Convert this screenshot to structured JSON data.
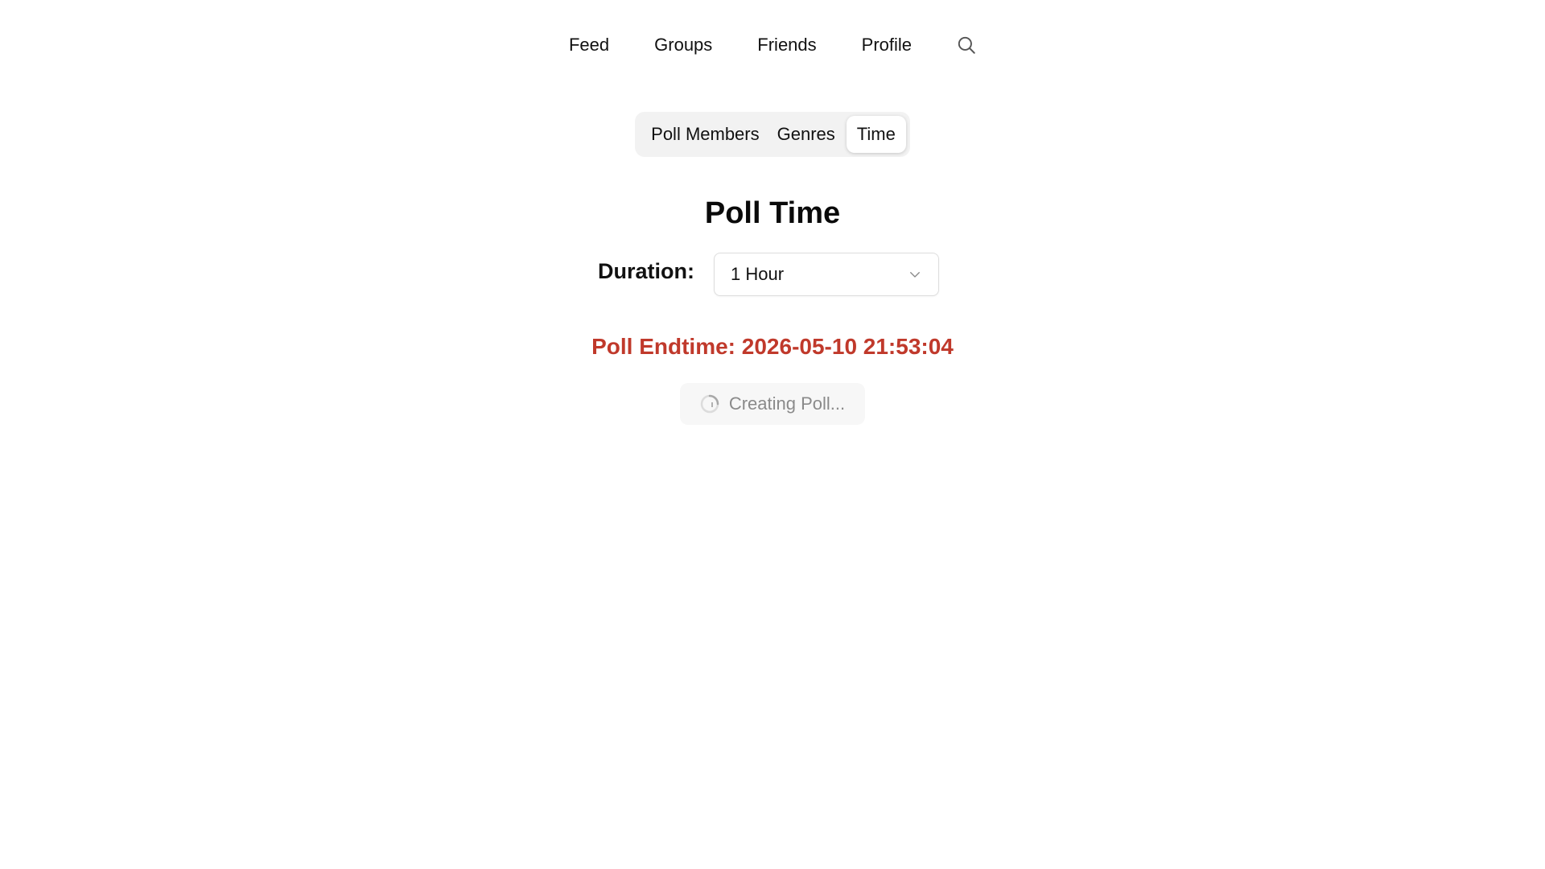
{
  "nav": {
    "items": [
      {
        "label": "Feed"
      },
      {
        "label": "Groups"
      },
      {
        "label": "Friends"
      },
      {
        "label": "Profile"
      }
    ],
    "search_icon": "search-icon"
  },
  "tabs": {
    "items": [
      {
        "label": "Poll Members",
        "active": false
      },
      {
        "label": "Genres",
        "active": false
      },
      {
        "label": "Time",
        "active": true
      }
    ]
  },
  "main": {
    "title": "Poll Time",
    "duration_label": "Duration:",
    "duration_value": "1 Hour",
    "endtime_text": "Poll Endtime: 2026-05-10 21:53:04",
    "create_button_label": "Creating Poll...",
    "create_button_state": "loading"
  },
  "colors": {
    "endtime": "#c0392b",
    "tab_bg": "#f2f2f2",
    "button_bg": "#f7f7f7",
    "button_text": "#8a8a8a"
  }
}
